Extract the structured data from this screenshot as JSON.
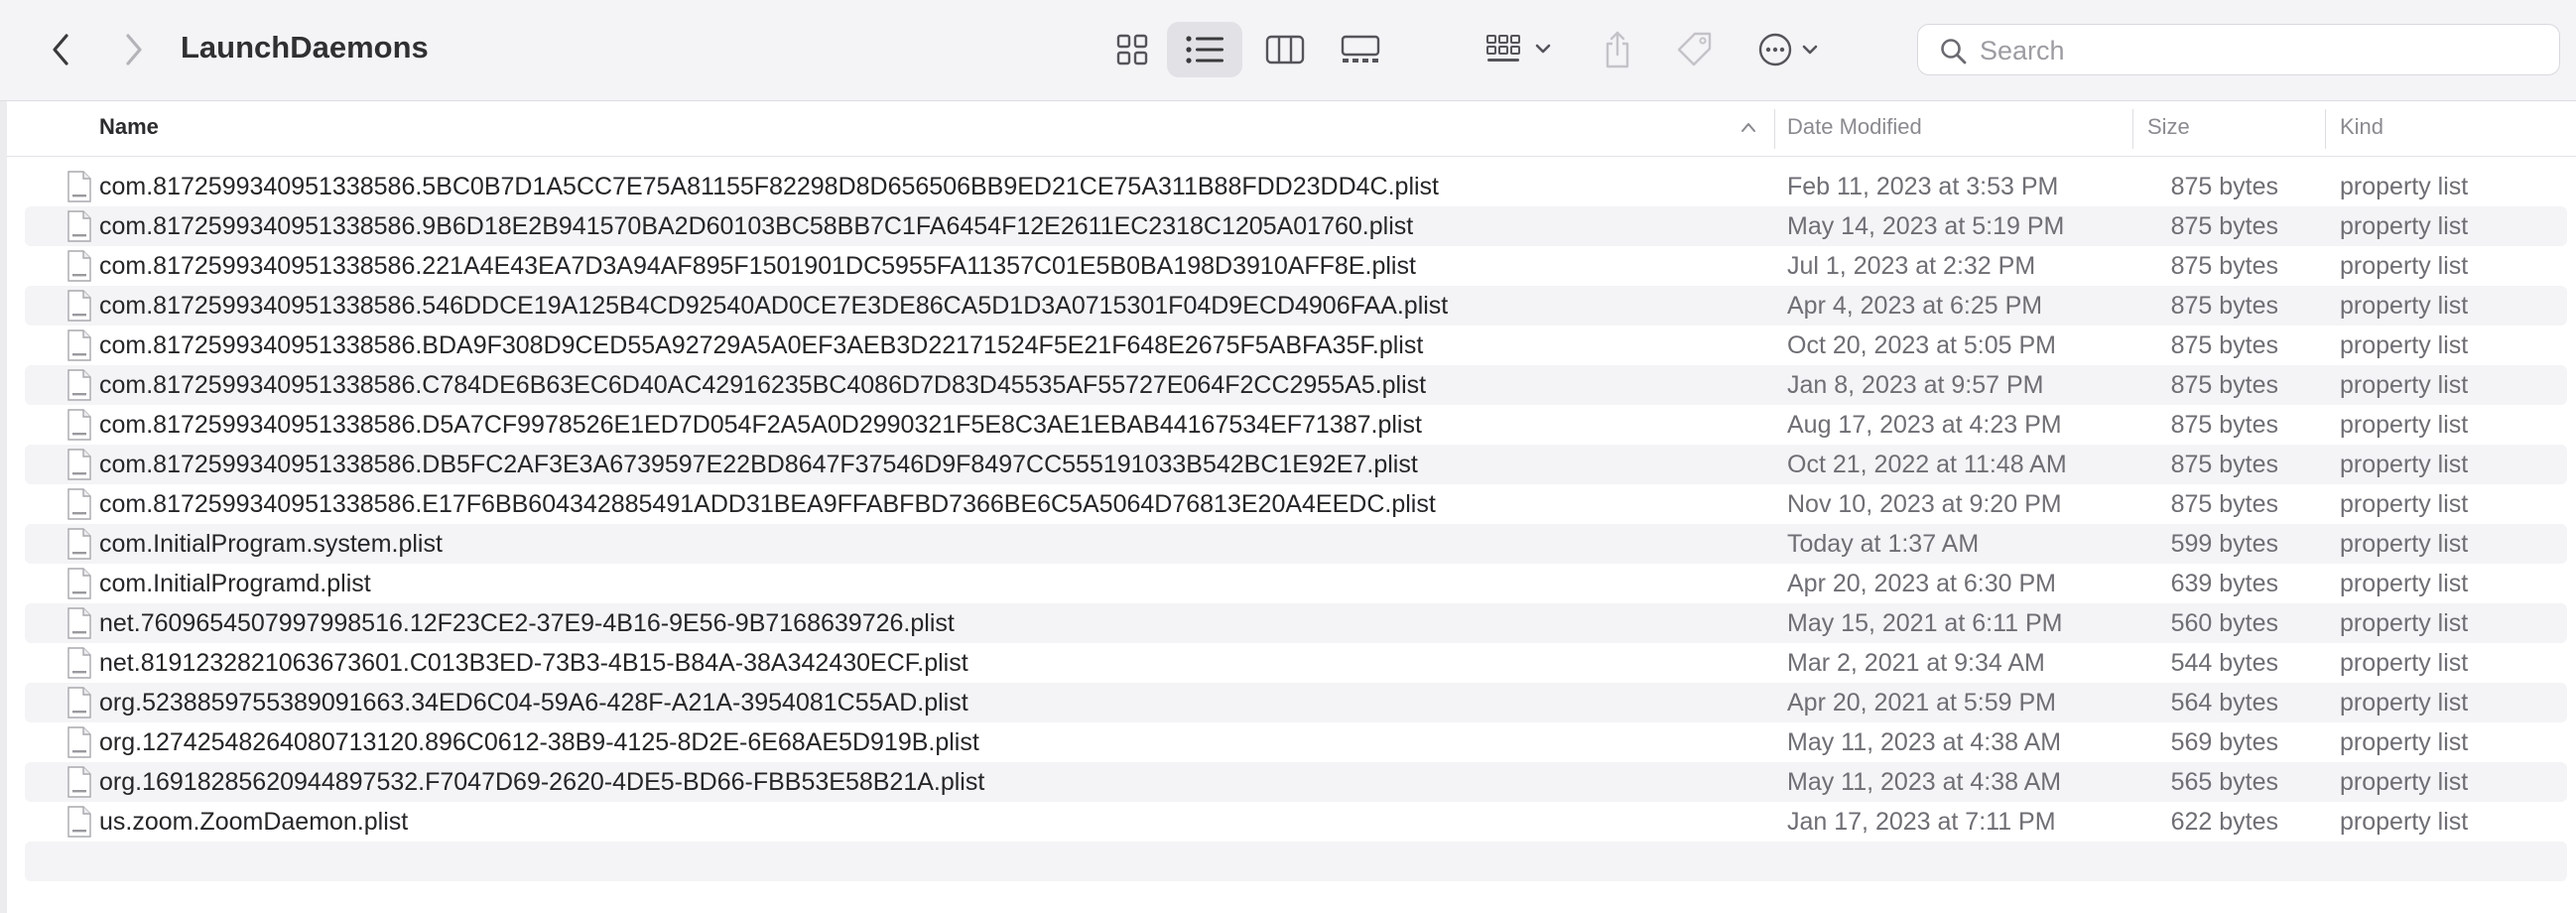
{
  "window": {
    "title": "LaunchDaemons"
  },
  "search": {
    "placeholder": "Search"
  },
  "columns": {
    "name": "Name",
    "date": "Date Modified",
    "size": "Size",
    "kind": "Kind"
  },
  "view_mode": "list",
  "sort": {
    "column": "Name",
    "direction": "ascending"
  },
  "files": [
    {
      "name": "com.8172599340951338586.5BC0B7D1A5CC7E75A81155F82298D8D656506BB9ED21CE75A311B88FDD23DD4C.plist",
      "date": "Feb 11, 2023 at 3:53 PM",
      "size": "875 bytes",
      "kind": "property list"
    },
    {
      "name": "com.8172599340951338586.9B6D18E2B941570BA2D60103BC58BB7C1FA6454F12E2611EC2318C1205A01760.plist",
      "date": "May 14, 2023 at 5:19 PM",
      "size": "875 bytes",
      "kind": "property list"
    },
    {
      "name": "com.8172599340951338586.221A4E43EA7D3A94AF895F1501901DC5955FA11357C01E5B0BA198D3910AFF8E.plist",
      "date": "Jul 1, 2023 at 2:32 PM",
      "size": "875 bytes",
      "kind": "property list"
    },
    {
      "name": "com.8172599340951338586.546DDCE19A125B4CD92540AD0CE7E3DE86CA5D1D3A0715301F04D9ECD4906FAA.plist",
      "date": "Apr 4, 2023 at 6:25 PM",
      "size": "875 bytes",
      "kind": "property list"
    },
    {
      "name": "com.8172599340951338586.BDA9F308D9CED55A92729A5A0EF3AEB3D22171524F5E21F648E2675F5ABFA35F.plist",
      "date": "Oct 20, 2023 at 5:05 PM",
      "size": "875 bytes",
      "kind": "property list"
    },
    {
      "name": "com.8172599340951338586.C784DE6B63EC6D40AC42916235BC4086D7D83D45535AF55727E064F2CC2955A5.plist",
      "date": "Jan 8, 2023 at 9:57 PM",
      "size": "875 bytes",
      "kind": "property list"
    },
    {
      "name": "com.8172599340951338586.D5A7CF9978526E1ED7D054F2A5A0D2990321F5E8C3AE1EBAB44167534EF71387.plist",
      "date": "Aug 17, 2023 at 4:23 PM",
      "size": "875 bytes",
      "kind": "property list"
    },
    {
      "name": "com.8172599340951338586.DB5FC2AF3E3A6739597E22BD8647F37546D9F8497CC555191033B542BC1E92E7.plist",
      "date": "Oct 21, 2022 at 11:48 AM",
      "size": "875 bytes",
      "kind": "property list"
    },
    {
      "name": "com.8172599340951338586.E17F6BB604342885491ADD31BEA9FFABFBD7366BE6C5A5064D76813E20A4EEDC.plist",
      "date": "Nov 10, 2023 at 9:20 PM",
      "size": "875 bytes",
      "kind": "property list"
    },
    {
      "name": "com.InitialProgram.system.plist",
      "date": "Today at 1:37 AM",
      "size": "599 bytes",
      "kind": "property list"
    },
    {
      "name": "com.InitialProgramd.plist",
      "date": "Apr 20, 2023 at 6:30 PM",
      "size": "639 bytes",
      "kind": "property list"
    },
    {
      "name": "net.7609654507997998516.12F23CE2-37E9-4B16-9E56-9B7168639726.plist",
      "date": "May 15, 2021 at 6:11 PM",
      "size": "560 bytes",
      "kind": "property list"
    },
    {
      "name": "net.8191232821063673601.C013B3ED-73B3-4B15-B84A-38A342430ECF.plist",
      "date": "Mar 2, 2021 at 9:34 AM",
      "size": "544 bytes",
      "kind": "property list"
    },
    {
      "name": "org.5238859755389091663.34ED6C04-59A6-428F-A21A-3954081C55AD.plist",
      "date": "Apr 20, 2021 at 5:59 PM",
      "size": "564 bytes",
      "kind": "property list"
    },
    {
      "name": "org.12742548264080713120.896C0612-38B9-4125-8D2E-6E68AE5D919B.plist",
      "date": "May 11, 2023 at 4:38 AM",
      "size": "569 bytes",
      "kind": "property list"
    },
    {
      "name": "org.16918285620944897532.F7047D69-2620-4DE5-BD66-FBB53E58B21A.plist",
      "date": "May 11, 2023 at 4:38 AM",
      "size": "565 bytes",
      "kind": "property list"
    },
    {
      "name": "us.zoom.ZoomDaemon.plist",
      "date": "Jan 17, 2023 at 7:11 PM",
      "size": "622 bytes",
      "kind": "property list"
    }
  ],
  "icons": {
    "back": "chevron-left-icon",
    "forward": "chevron-right-icon",
    "icon_view": "grid-icon",
    "list_view": "list-icon",
    "column_view": "columns-icon",
    "gallery_view": "gallery-icon",
    "group": "group-icon",
    "share": "share-icon",
    "tags": "tag-icon",
    "more": "ellipsis-icon",
    "search": "search-icon",
    "file": "plist-file-icon",
    "sort": "chevron-up-icon"
  }
}
